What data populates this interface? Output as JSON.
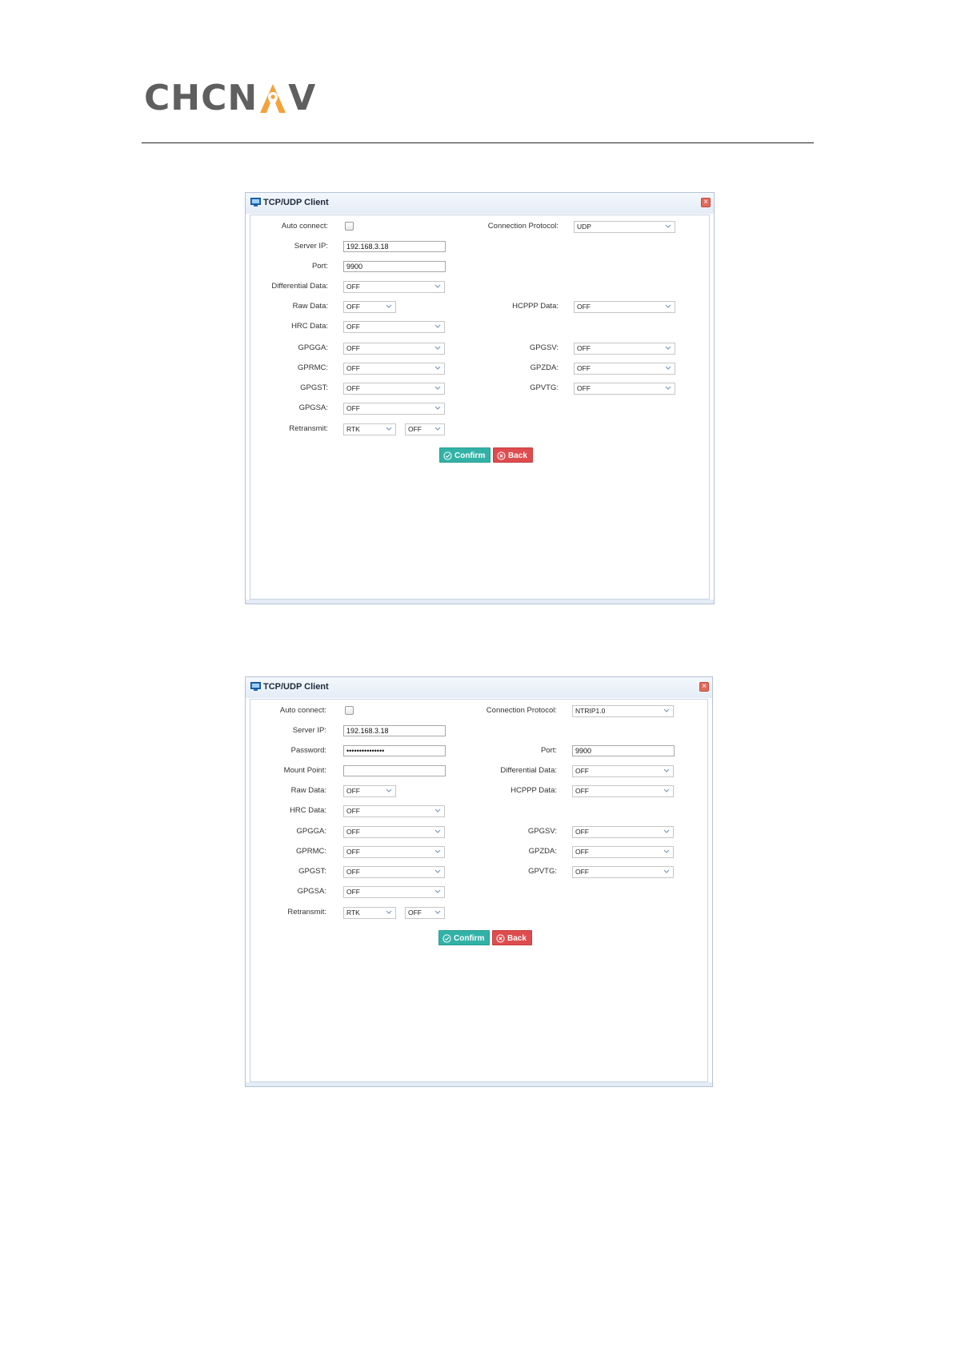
{
  "logo": {
    "part1": "CHCN",
    "part2": "V",
    "brand_color": "#5f5f5f",
    "accent_color": "#f4a23a"
  },
  "dialogs": [
    {
      "title": "TCP/UDP Client",
      "close_icon": "close-icon",
      "labels": {
        "auto_connect": "Auto connect:",
        "server_ip": "Server IP:",
        "port": "Port:",
        "differential_data": "Differential Data:",
        "raw_data": "Raw Data:",
        "hrc_data": "HRC Data:",
        "gpgga": "GPGGA:",
        "gprmc": "GPRMC:",
        "gpgst": "GPGST:",
        "gpgsa": "GPGSA:",
        "retransmit": "Retransmit:",
        "connection_protocol": "Connection Protocol:",
        "hcppp_data": "HCPPP Data:",
        "gpgsv": "GPGSV:",
        "gpzda": "GPZDA:",
        "gpvtg": "GPVTG:"
      },
      "values": {
        "auto_connect": false,
        "server_ip": "192.168.3.18",
        "port": "9900",
        "differential_data": "OFF",
        "raw_data": "OFF",
        "hrc_data": "OFF",
        "gpgga": "OFF",
        "gprmc": "OFF",
        "gpgst": "OFF",
        "gpgsa": "OFF",
        "retransmit_type": "RTK",
        "retransmit_state": "OFF",
        "connection_protocol": "UDP",
        "hcppp_data": "OFF",
        "gpgsv": "OFF",
        "gpzda": "OFF",
        "gpvtg": "OFF"
      },
      "buttons": {
        "confirm": "Confirm",
        "back": "Back"
      }
    },
    {
      "title": "TCP/UDP Client",
      "close_icon": "close-icon",
      "labels": {
        "auto_connect": "Auto connect:",
        "server_ip": "Server IP:",
        "password": "Password:",
        "mount_point": "Mount Point:",
        "raw_data": "Raw Data:",
        "hrc_data": "HRC Data:",
        "gpgga": "GPGGA:",
        "gprmc": "GPRMC:",
        "gpgst": "GPGST:",
        "gpgsa": "GPGSA:",
        "retransmit": "Retransmit:",
        "connection_protocol": "Connection Protocol:",
        "port": "Port:",
        "differential_data": "Differential Data:",
        "hcppp_data": "HCPPP Data:",
        "gpgsv": "GPGSV:",
        "gpzda": "GPZDA:",
        "gpvtg": "GPVTG:"
      },
      "values": {
        "auto_connect": false,
        "server_ip": "192.168.3.18",
        "password": "•••••••••••••••",
        "mount_point": "",
        "raw_data": "OFF",
        "hrc_data": "OFF",
        "gpgga": "OFF",
        "gprmc": "OFF",
        "gpgst": "OFF",
        "gpgsa": "OFF",
        "retransmit_type": "RTK",
        "retransmit_state": "OFF",
        "connection_protocol": "NTRIP1.0",
        "port": "9900",
        "differential_data": "OFF",
        "hcppp_data": "OFF",
        "gpgsv": "OFF",
        "gpzda": "OFF",
        "gpvtg": "OFF"
      },
      "buttons": {
        "confirm": "Confirm",
        "back": "Back"
      }
    }
  ],
  "colors": {
    "confirm_button": "#32b2a7",
    "back_button": "#de4c4f",
    "title_icon": "#1e6fc4"
  }
}
